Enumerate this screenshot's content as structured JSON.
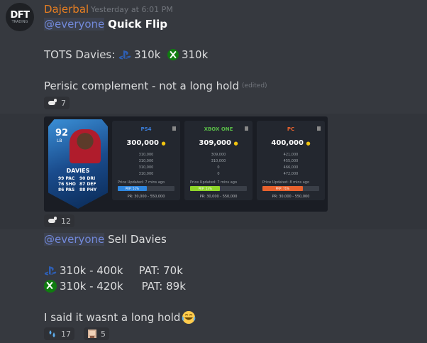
{
  "message": {
    "username": "Dajerbal",
    "timestamp": "Yesterday at 6:01 PM",
    "avatar_text": "DFT",
    "avatar_sub": "TRADING",
    "mention": "@everyone",
    "title": "Quick Flip",
    "tots_label": "TOTS Davies:",
    "ps_price": "310k",
    "xb_price": "310k",
    "note": "Perisic complement - not a long hold",
    "edited": "(edited)",
    "reaction1_count": "7",
    "reaction2_count": "12"
  },
  "card_image": {
    "player": {
      "rating": "92",
      "position": "LB",
      "name": "DAVIES",
      "stats_left": [
        "99 PAC",
        "76 SHO",
        "86 PAS"
      ],
      "stats_right": [
        "90 DRI",
        "87 DEF",
        "88 PHY"
      ]
    },
    "platforms": [
      {
        "name": "PS4",
        "color": "#3b7dd8",
        "price": "300,000",
        "others": [
          "310,000",
          "310,000",
          "310,000",
          "310,000"
        ],
        "updated": "Price Updated: 7 mins ago",
        "prp": "PRP: 51%",
        "prp_pct": 51,
        "bar_color": "#2e86de",
        "range": "PR: 30,000 - 550,000"
      },
      {
        "name": "XBOX ONE",
        "color": "#58b947",
        "price": "309,000",
        "others": [
          "309,000",
          "310,000",
          "0",
          "0"
        ],
        "updated": "Price Updated: 7 mins ago",
        "prp": "PRP: 53%",
        "prp_pct": 53,
        "bar_color": "#8fd62a",
        "range": "PR: 30,000 - 550,000"
      },
      {
        "name": "PC",
        "color": "#e8622e",
        "price": "400,000",
        "others": [
          "421,000",
          "455,000",
          "466,000",
          "472,000"
        ],
        "updated": "Price Updated: 8 mins ago",
        "prp": "PRP: 71%",
        "prp_pct": 71,
        "bar_color": "#e8622e",
        "range": "PR: 30,000 - 550,000"
      }
    ]
  },
  "sell": {
    "mention": "@everyone",
    "text": "Sell Davies",
    "ps_line": "310k - 400k",
    "ps_pat": "PAT: 70k",
    "xb_line": "310k - 420k",
    "xb_pat": "PAT: 89k",
    "footer": "I said it wasnt a long hold",
    "reaction3_count": "17",
    "reaction4_count": "5"
  },
  "colors": {
    "background": "#36393f",
    "username": "#e67e22",
    "mention": "#7289da"
  }
}
